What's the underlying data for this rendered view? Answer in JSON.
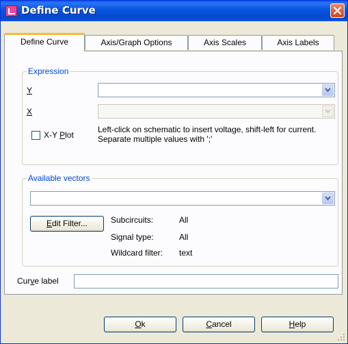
{
  "window": {
    "title": "Define Curve"
  },
  "tabs": [
    {
      "label": "Define Curve",
      "active": true
    },
    {
      "label": "Axis/Graph Options",
      "active": false
    },
    {
      "label": "Axis Scales",
      "active": false
    },
    {
      "label": "Axis Labels",
      "active": false
    }
  ],
  "expression": {
    "group_label": "Expression",
    "y_label": "Y",
    "y_value": "",
    "x_label": "X",
    "x_value": "",
    "xy_plot": {
      "label_pre": "X-Y ",
      "label_mnemonic": "P",
      "label_post": "lot",
      "checked": false
    },
    "hint": "Left-click on schematic to insert voltage, shift-left for current. Separate multiple values with ';'"
  },
  "vectors": {
    "group_label": "Available vectors",
    "value": "",
    "edit_filter": {
      "mnemonic": "E",
      "rest": "dit Filter..."
    },
    "subcircuits_label": "Subcircuits:",
    "subcircuits_value": "All",
    "signal_type_label": "Signal type:",
    "signal_type_value": "All",
    "wildcard_label": "Wildcard filter:",
    "wildcard_value": "text"
  },
  "curve_label": {
    "pre": "Cur",
    "mnemonic": "v",
    "post": "e label",
    "value": ""
  },
  "buttons": {
    "ok": {
      "mnemonic": "O",
      "rest": "k"
    },
    "cancel": {
      "mnemonic": "C",
      "rest": "ancel"
    },
    "help": {
      "mnemonic": "H",
      "rest": "elp"
    }
  },
  "colors": {
    "title_bar": "#0a57e0",
    "group_title": "#0046d5",
    "active_tab_accent": "#f7b93c",
    "dialog_bg": "#ece9d8"
  }
}
